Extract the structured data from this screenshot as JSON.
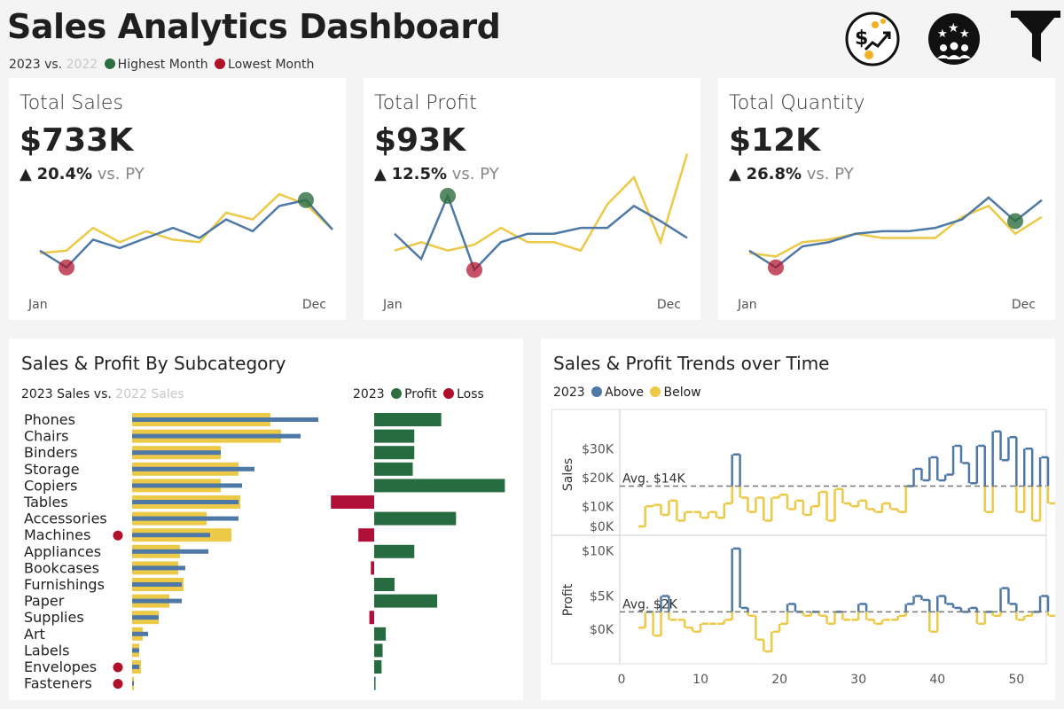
{
  "header": {
    "title": "Sales Analytics Dashboard",
    "year_current": "2023",
    "vs_label": "vs.",
    "year_prior": "2022",
    "highest_label": "Highest Month",
    "lowest_label": "Lowest Month"
  },
  "icons": [
    "sales-growth-icon",
    "customers-stars-icon",
    "filter-funnel-icon"
  ],
  "colors": {
    "current": "#4e79a7",
    "prior": "#edc948",
    "high": "#2e6e3e",
    "low": "#b0102a",
    "profit_bar": "#276b40",
    "loss_bar": "#b01038"
  },
  "kpis": [
    {
      "title": "Total Sales",
      "value": "$733K",
      "delta": "20.4%",
      "vs": "vs. PY",
      "start": "Jan",
      "end": "Dec",
      "current": [
        0.35,
        0.15,
        0.48,
        0.38,
        0.5,
        0.62,
        0.5,
        0.72,
        0.58,
        0.88,
        0.95,
        0.6
      ],
      "prior": [
        0.32,
        0.35,
        0.62,
        0.45,
        0.58,
        0.48,
        0.45,
        0.8,
        0.72,
        1.02,
        0.9,
        0.6
      ],
      "high_idx": 10,
      "low_idx": 1
    },
    {
      "title": "Total Profit",
      "value": "$93K",
      "delta": "12.5%",
      "vs": "vs. PY",
      "start": "Jan",
      "end": "Dec",
      "current": [
        0.55,
        0.25,
        1.0,
        0.12,
        0.45,
        0.55,
        0.55,
        0.62,
        0.62,
        0.88,
        0.7,
        0.5
      ],
      "prior": [
        0.35,
        0.45,
        0.35,
        0.42,
        0.62,
        0.45,
        0.45,
        0.35,
        0.9,
        1.22,
        0.45,
        1.5
      ],
      "high_idx": 2,
      "low_idx": 3
    },
    {
      "title": "Total Quantity",
      "value": "$12K",
      "delta": "26.8%",
      "vs": "vs. PY",
      "start": "Jan",
      "end": "Dec",
      "current": [
        0.35,
        0.15,
        0.4,
        0.45,
        0.55,
        0.58,
        0.58,
        0.62,
        0.72,
        0.98,
        0.7,
        0.95
      ],
      "prior": [
        0.32,
        0.28,
        0.45,
        0.48,
        0.55,
        0.5,
        0.5,
        0.5,
        0.75,
        0.88,
        0.55,
        0.75
      ],
      "high_idx": 10,
      "low_idx": 1
    }
  ],
  "subcat": {
    "title": "Sales & Profit By Subcategory",
    "legend_left": {
      "year": "2023 Sales",
      "vs": "vs.",
      "prior": "2022 Sales"
    },
    "legend_right": {
      "year": "2023",
      "profit": "Profit",
      "loss": "Loss"
    }
  },
  "trends": {
    "title": "Sales & Profit Trends over Time",
    "legend": {
      "year": "2023",
      "above": "Above",
      "below": "Below"
    },
    "sales_label": "Sales",
    "profit_label": "Profit",
    "sales_avg_label": "Avg. $14K",
    "profit_avg_label": "Avg. $2K",
    "sales_ticks": [
      "$0K",
      "$10K",
      "$20K",
      "$30K"
    ],
    "profit_ticks": [
      "$0K",
      "$5K",
      "$10K"
    ],
    "x_ticks": [
      "0",
      "10",
      "20",
      "30",
      "40",
      "50"
    ]
  },
  "chart_data": [
    {
      "type": "bar",
      "title": "Sales & Profit By Subcategory",
      "categories": [
        "Phones",
        "Chairs",
        "Binders",
        "Storage",
        "Copiers",
        "Tables",
        "Accessories",
        "Machines",
        "Appliances",
        "Bookcases",
        "Furnishings",
        "Paper",
        "Supplies",
        "Art",
        "Labels",
        "Envelopes",
        "Fasteners"
      ],
      "series": [
        {
          "name": "2023 Sales",
          "values": [
            105,
            95,
            50,
            69,
            62,
            60,
            60,
            44,
            43,
            30,
            28,
            28,
            15,
            9,
            4,
            4,
            1
          ]
        },
        {
          "name": "2022 Sales",
          "values": [
            78,
            84,
            50,
            60,
            50,
            61,
            42,
            56,
            27,
            26,
            29,
            21,
            15,
            6,
            4,
            5,
            1
          ]
        },
        {
          "name": "Profit",
          "values": [
            44.5,
            26.6,
            26.6,
            25.6,
            86.7,
            -28.7,
            54.3,
            -10.5,
            26.6,
            -2.2,
            13.5,
            41.8,
            -3.2,
            7.7,
            5.6,
            4.9,
            0.9
          ]
        }
      ],
      "loss_markers": [
        "Machines",
        "Envelopes",
        "Fasteners"
      ]
    },
    {
      "type": "line",
      "title": "Sales & Profit Trends over Time",
      "x": [
        1,
        2,
        3,
        4,
        5,
        6,
        7,
        8,
        9,
        10,
        11,
        12,
        13,
        14,
        15,
        16,
        17,
        18,
        19,
        20,
        21,
        22,
        23,
        24,
        25,
        26,
        27,
        28,
        29,
        30,
        31,
        32,
        33,
        34,
        35,
        36,
        37,
        38,
        39,
        40,
        41,
        42,
        43,
        44,
        45,
        46,
        47,
        48,
        49,
        50,
        51,
        52,
        53
      ],
      "series": [
        {
          "name": "Sales",
          "values": [
            0,
            7,
            7.5,
            4,
            9,
            2,
            5,
            5,
            3,
            5,
            3,
            8,
            25,
            10,
            5,
            10,
            2,
            10,
            11,
            6,
            9,
            4,
            7,
            12,
            2,
            13,
            8,
            7,
            9,
            6,
            5,
            8,
            6,
            5,
            14,
            20,
            16,
            24,
            16,
            18,
            28,
            22,
            15,
            28,
            5,
            33,
            23,
            31,
            5,
            27,
            2,
            24,
            8
          ],
          "avg": 14
        },
        {
          "name": "Profit",
          "values": [
            0,
            2,
            -1,
            4,
            1,
            1,
            0,
            -0.5,
            0.5,
            0.5,
            0.5,
            1,
            10,
            2.5,
            1.5,
            -1.5,
            -3,
            -0.5,
            0.5,
            3,
            2,
            1.5,
            2,
            1.5,
            0.5,
            2,
            1,
            1,
            3,
            1,
            0.5,
            1,
            1,
            1.5,
            3,
            4,
            3.5,
            -0.5,
            4,
            3,
            2.5,
            2,
            2.5,
            0.5,
            2,
            1.5,
            5,
            3,
            1,
            1.5,
            2,
            4,
            1.5
          ],
          "avg": 2
        }
      ],
      "xlim": [
        0,
        54
      ],
      "ylabel": [
        "Sales",
        "Profit"
      ]
    }
  ]
}
